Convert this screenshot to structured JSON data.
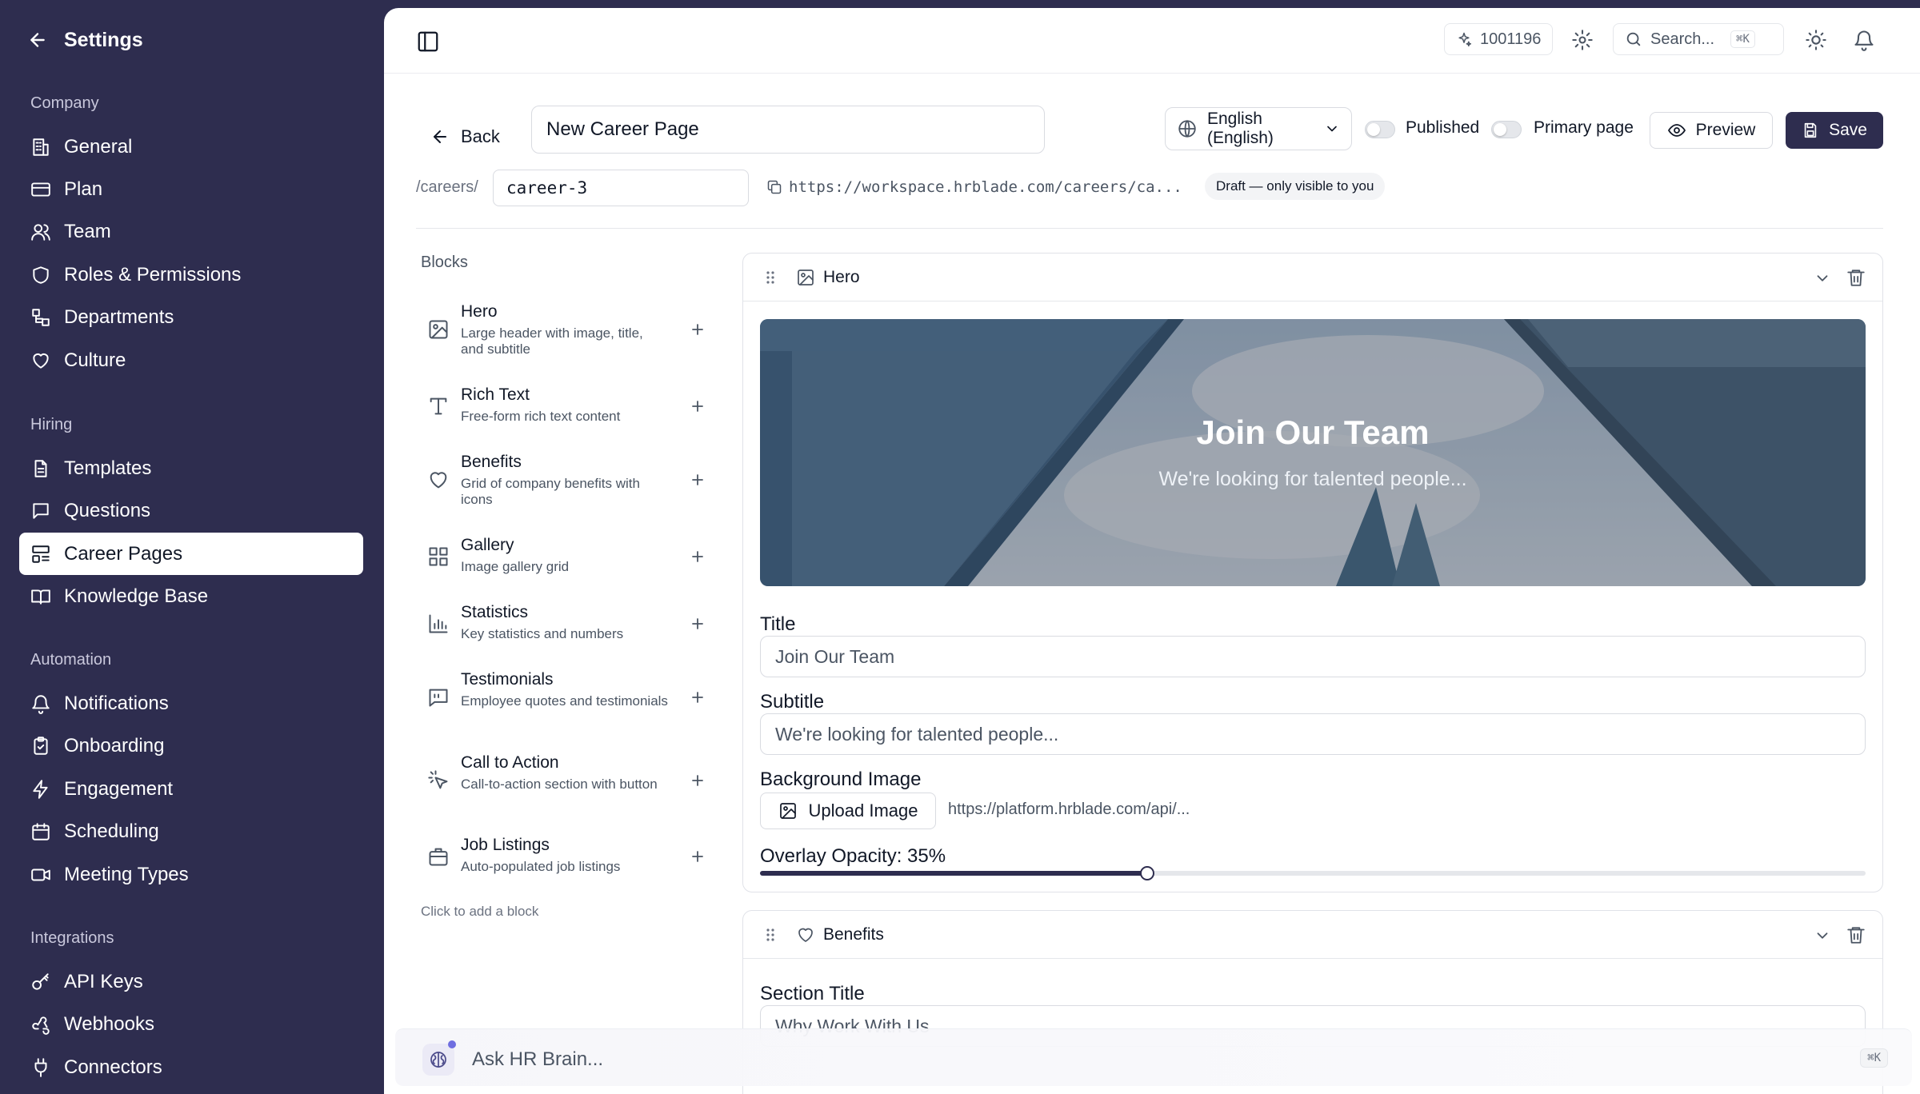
{
  "sidebar": {
    "title": "Settings",
    "sections": {
      "company": "Company",
      "hiring": "Hiring",
      "automation": "Automation",
      "integrations": "Integrations"
    },
    "company_items": [
      "General",
      "Plan",
      "Team",
      "Roles & Permissions",
      "Departments",
      "Culture"
    ],
    "hiring_items": [
      "Templates",
      "Questions",
      "Career Pages",
      "Knowledge Base"
    ],
    "automation_items": [
      "Notifications",
      "Onboarding",
      "Engagement",
      "Scheduling",
      "Meeting Types"
    ],
    "integration_items": [
      "API Keys",
      "Webhooks",
      "Connectors"
    ],
    "active_item": "Career Pages"
  },
  "topbar": {
    "credits": "1001196",
    "search_placeholder": "Search...",
    "search_shortcut": "⌘K"
  },
  "toolbar": {
    "back_label": "Back",
    "page_name": "New Career Page",
    "language": "English (English)",
    "published_label": "Published",
    "primary_label": "Primary page",
    "preview_label": "Preview",
    "save_label": "Save"
  },
  "slug": {
    "prefix": "/careers/",
    "value": "career-3",
    "url": "https://workspace.hrblade.com/careers/ca...",
    "status_badge": "Draft — only visible to you"
  },
  "blocks": {
    "title": "Blocks",
    "hint": "Click to add a block",
    "items": [
      {
        "name": "Hero",
        "desc": "Large header with image, title, and subtitle",
        "icon": "image-icon"
      },
      {
        "name": "Rich Text",
        "desc": "Free-form rich text content",
        "icon": "type-icon"
      },
      {
        "name": "Benefits",
        "desc": "Grid of company benefits with icons",
        "icon": "heart-icon"
      },
      {
        "name": "Gallery",
        "desc": "Image gallery grid",
        "icon": "grid-icon"
      },
      {
        "name": "Statistics",
        "desc": "Key statistics and numbers",
        "icon": "bar-chart-icon"
      },
      {
        "name": "Testimonials",
        "desc": "Employee quotes and testimonials",
        "icon": "quote-icon"
      },
      {
        "name": "Call to Action",
        "desc": "Call-to-action section with button",
        "icon": "pointer-click-icon"
      },
      {
        "name": "Job Listings",
        "desc": "Auto-populated job listings",
        "icon": "briefcase-icon"
      }
    ]
  },
  "hero_card": {
    "title": "Hero",
    "preview_title": "Join Our Team",
    "preview_subtitle": "We're looking for talented people...",
    "title_label": "Title",
    "title_value": "Join Our Team",
    "subtitle_label": "Subtitle",
    "subtitle_value": "We're looking for talented people...",
    "bg_label": "Background Image",
    "upload_label": "Upload Image",
    "bg_url": "https://platform.hrblade.com/api/...",
    "opacity_label": "Overlay Opacity: 35%",
    "opacity_value": 0.35
  },
  "benefits_card": {
    "title": "Benefits",
    "section_title_label": "Section Title",
    "section_title_value": "Why Work With Us"
  },
  "ask": {
    "placeholder": "Ask HR Brain...",
    "shortcut": "⌘K"
  },
  "colors": {
    "brand": "#2e2d4f",
    "accent_dot": "#6f6ee0"
  }
}
